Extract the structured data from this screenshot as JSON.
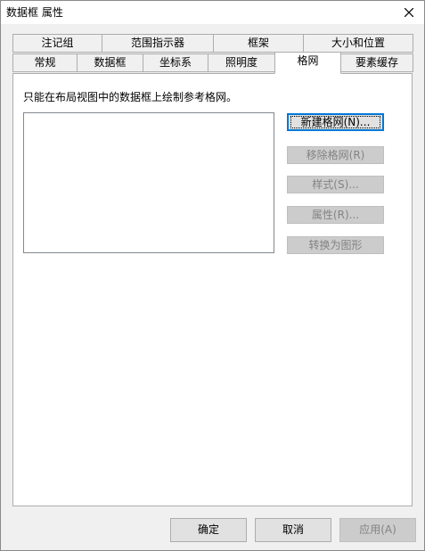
{
  "window": {
    "title": "数据框 属性"
  },
  "tabs": {
    "row_back": [
      {
        "label": "注记组"
      },
      {
        "label": "范围指示器"
      },
      {
        "label": "框架"
      },
      {
        "label": "大小和位置"
      }
    ],
    "row_front": [
      {
        "label": "常规"
      },
      {
        "label": "数据框"
      },
      {
        "label": "坐标系"
      },
      {
        "label": "照明度"
      },
      {
        "label": "格网",
        "active": true
      },
      {
        "label": "要素缓存"
      }
    ]
  },
  "grid_panel": {
    "instruction": "只能在布局视图中的数据框上绘制参考格网。",
    "buttons": {
      "new_grid": "新建格网(N)...",
      "remove_grid": "移除格网(R)",
      "style": "样式(S)...",
      "properties": "属性(R)...",
      "convert_to_graphics": "转换为图形"
    }
  },
  "footer": {
    "ok": "确定",
    "cancel": "取消",
    "apply": "应用(A)"
  },
  "colors": {
    "accent": "#0078d7",
    "dialog_bg": "#f0f0f0",
    "button_bg": "#e1e1e1",
    "disabled_text": "#838383"
  }
}
